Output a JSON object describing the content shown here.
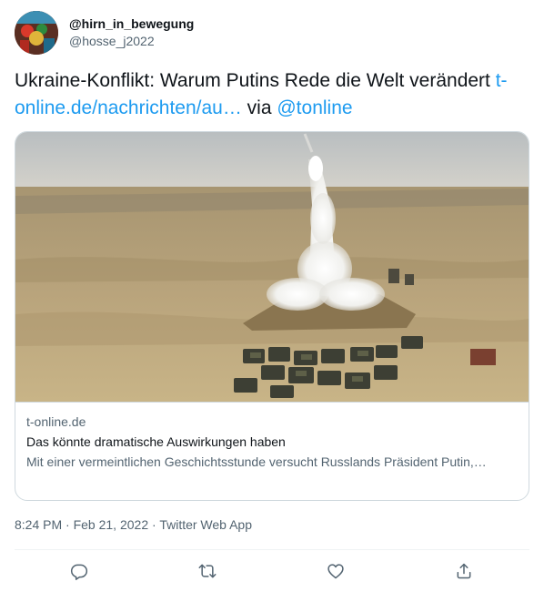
{
  "author": {
    "display_name": "@hirn_in_bewegung",
    "handle": "@hosse_j2022",
    "avatar_icon": "avatar-image"
  },
  "tweet": {
    "text_plain": "Ukraine-Konflikt: Warum Putins Rede die Welt verändert ",
    "link_text": "t-online.de/nachrichten/au…",
    "via_text": " via ",
    "mention": "@tonline"
  },
  "card": {
    "image_alt": "missile-launch-photo",
    "domain": "t-online.de",
    "title": "Das könnte dramatische Auswirkungen haben",
    "description": "Mit einer vermeintlichen Geschichtsstunde versucht Russlands Präsident Putin,…"
  },
  "meta": {
    "time": "8:24 PM",
    "separator": " · ",
    "date": "Feb 21, 2022",
    "source": "Twitter Web App"
  },
  "actions": {
    "reply_icon": "reply-icon",
    "retweet_icon": "retweet-icon",
    "like_icon": "like-icon",
    "share_icon": "share-icon"
  },
  "colors": {
    "link": "#1d9bf0",
    "secondary_text": "#536471",
    "border": "#cfd9de"
  }
}
